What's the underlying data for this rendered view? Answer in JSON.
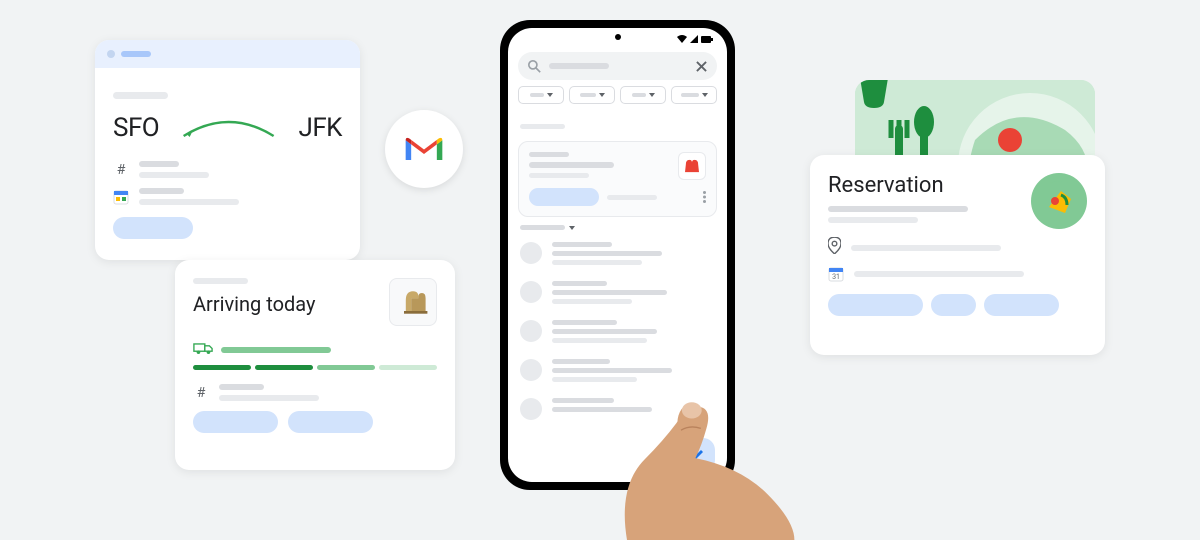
{
  "flight": {
    "origin": "SFO",
    "destination": "JFK"
  },
  "arriving": {
    "title": "Arriving today"
  },
  "reservation": {
    "title": "Reservation"
  },
  "icons": {
    "hash": "#"
  }
}
